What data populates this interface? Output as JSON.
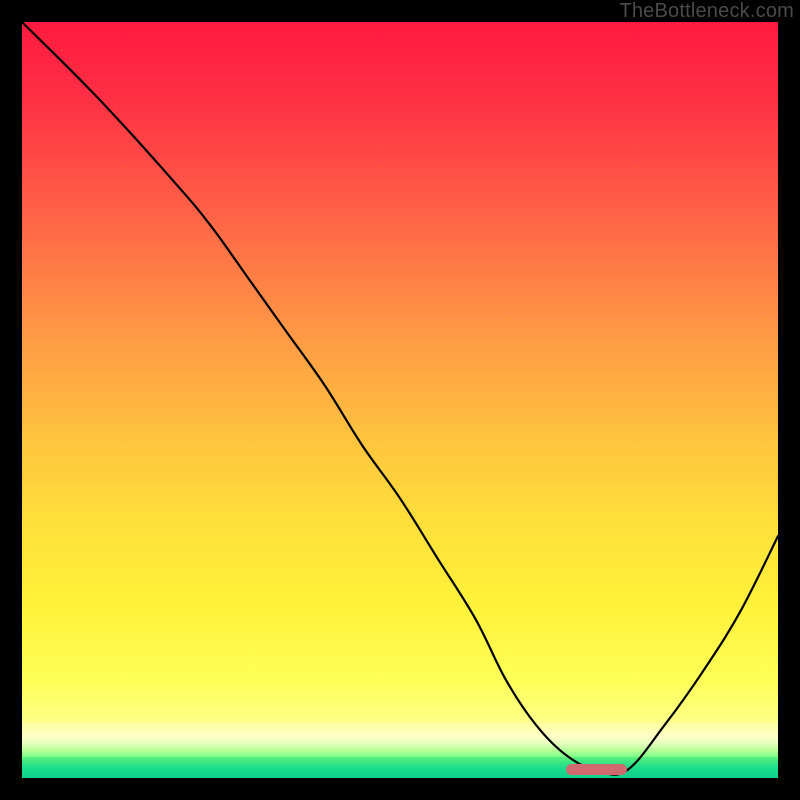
{
  "watermark": "TheBottleneck.com",
  "chart_data": {
    "type": "line",
    "title": "",
    "xlabel": "",
    "ylabel": "",
    "xlim": [
      0,
      100
    ],
    "ylim": [
      0,
      100
    ],
    "grid": false,
    "series": [
      {
        "name": "bottleneck-curve",
        "x": [
          0,
          10,
          20,
          25,
          30,
          35,
          40,
          45,
          50,
          55,
          60,
          64,
          68,
          72,
          76,
          80,
          85,
          90,
          95,
          100
        ],
        "values": [
          100,
          90,
          79,
          73,
          66,
          59,
          52,
          44,
          37,
          29,
          21,
          13,
          7,
          3,
          1,
          1,
          7,
          14,
          22,
          32
        ]
      }
    ],
    "optimum_region": {
      "x_start": 72,
      "x_end": 80,
      "y": 1
    },
    "background_gradient": {
      "stops": [
        {
          "pos": 0,
          "color": "#ff1a3f"
        },
        {
          "pos": 50,
          "color": "#ffb443"
        },
        {
          "pos": 92,
          "color": "#ffff58"
        },
        {
          "pos": 97,
          "color": "#b8ff9a"
        },
        {
          "pos": 100,
          "color": "#10d28c"
        }
      ]
    }
  },
  "colors": {
    "curve": "#000000",
    "marker": "#d06a6e",
    "background_black": "#000000"
  }
}
